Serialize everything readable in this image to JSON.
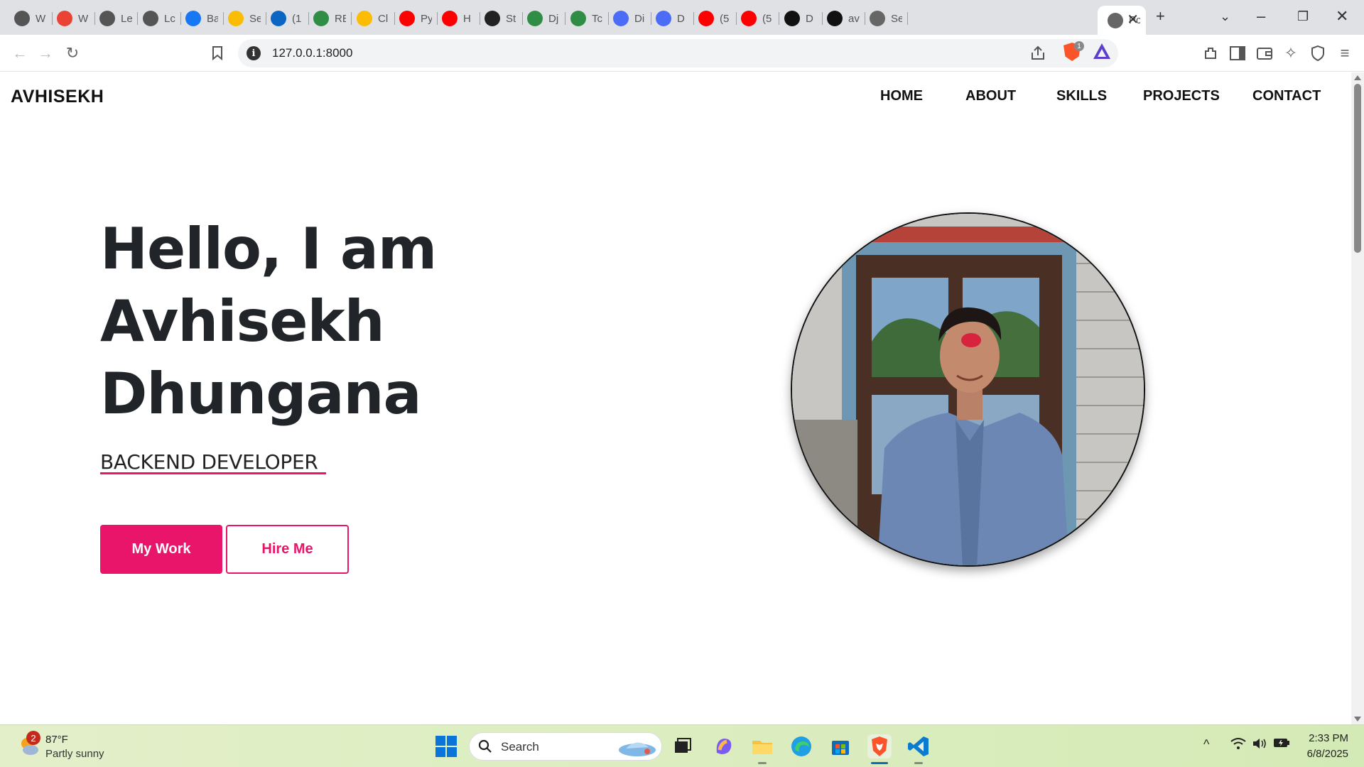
{
  "browser": {
    "tabs": [
      {
        "title": "W",
        "icon": "openai-icon",
        "color": "#555"
      },
      {
        "title": "W",
        "icon": "gmail-icon",
        "color": "#ea4335"
      },
      {
        "title": "Le",
        "icon": "openai-icon",
        "color": "#555"
      },
      {
        "title": "Lc",
        "icon": "openai-icon",
        "color": "#555"
      },
      {
        "title": "Ba",
        "icon": "facebook-icon",
        "color": "#1877f2"
      },
      {
        "title": "Se",
        "icon": "drive-icon",
        "color": "#fbbc04"
      },
      {
        "title": "(1",
        "icon": "linkedin-icon",
        "color": "#0a66c2"
      },
      {
        "title": "RE",
        "icon": "gfg-icon",
        "color": "#2f8d46"
      },
      {
        "title": "Cl",
        "icon": "drive-icon",
        "color": "#fbbc04"
      },
      {
        "title": "Py",
        "icon": "youtube-icon",
        "color": "#ff0000"
      },
      {
        "title": "H",
        "icon": "youtube-icon",
        "color": "#ff0000"
      },
      {
        "title": "St",
        "icon": "openai-icon",
        "color": "#222"
      },
      {
        "title": "Dj",
        "icon": "gfg-icon",
        "color": "#2f8d46"
      },
      {
        "title": "Tc",
        "icon": "gfg-icon",
        "color": "#2f8d46"
      },
      {
        "title": "Di",
        "icon": "devin-icon",
        "color": "#4a6cf7"
      },
      {
        "title": "D",
        "icon": "devin-icon",
        "color": "#4a6cf7"
      },
      {
        "title": "(5",
        "icon": "youtube-icon",
        "color": "#ff0000"
      },
      {
        "title": "(5",
        "icon": "youtube-icon",
        "color": "#ff0000"
      },
      {
        "title": "D",
        "icon": "openai-icon",
        "color": "#111"
      },
      {
        "title": "av",
        "icon": "github-icon",
        "color": "#111"
      },
      {
        "title": "Se",
        "icon": "globe-icon",
        "color": "#666"
      },
      {
        "title": "Pc",
        "icon": "page-icon",
        "color": "#666"
      }
    ],
    "url": "127.0.0.1:8000",
    "shield_count": "1"
  },
  "site": {
    "logo": "AVHISEKH",
    "nav": [
      "HOME",
      "ABOUT",
      "SKILLS",
      "PROJECTS",
      "CONTACT"
    ],
    "hero": {
      "line1": "Hello, I am",
      "line2": "Avhisekh",
      "line3": "Dhungana",
      "role": "BACKEND DEVELOPER",
      "btn_work": "My Work",
      "btn_hire": "Hire Me"
    },
    "accent": "#e8156b"
  },
  "taskbar": {
    "weather_badge": "2",
    "temp": "87°F",
    "condition": "Partly sunny",
    "search_label": "Search",
    "time": "2:33 PM",
    "date": "6/8/2025"
  }
}
